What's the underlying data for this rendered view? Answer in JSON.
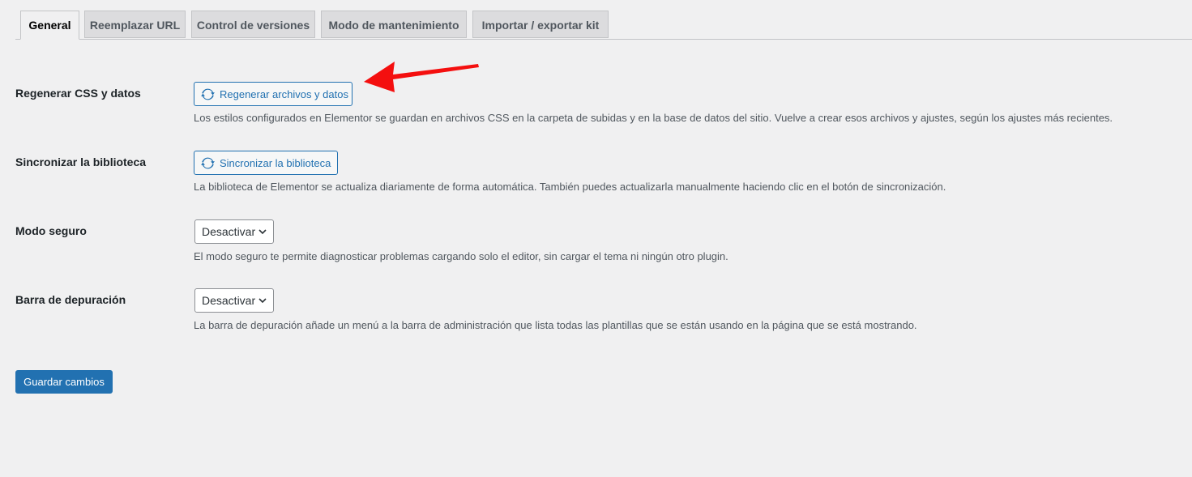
{
  "tabs": [
    {
      "label": "General",
      "active": true
    },
    {
      "label": "Reemplazar URL",
      "active": false
    },
    {
      "label": "Control de versiones",
      "active": false
    },
    {
      "label": "Modo de mantenimiento",
      "active": false
    },
    {
      "label": "Importar / exportar kit",
      "active": false
    }
  ],
  "rows": {
    "regenerate": {
      "label": "Regenerar CSS y datos",
      "button": "Regenerar archivos y datos",
      "icon": "sync-icon",
      "description": "Los estilos configurados en Elementor se guardan en archivos CSS en la carpeta de subidas y en la base de datos del sitio. Vuelve a crear esos archivos y ajustes, según los ajustes más recientes."
    },
    "sync": {
      "label": "Sincronizar la biblioteca",
      "button": "Sincronizar la biblioteca",
      "icon": "sync-icon",
      "description": "La biblioteca de Elementor se actualiza diariamente de forma automática. También puedes actualizarla manualmente haciendo clic en el botón de sincronización."
    },
    "safe_mode": {
      "label": "Modo seguro",
      "value": "Desactivar",
      "description": "El modo seguro te permite diagnosticar problemas cargando solo el editor, sin cargar el tema ni ningún otro plugin."
    },
    "debug_bar": {
      "label": "Barra de depuración",
      "value": "Desactivar",
      "description": "La barra de depuración añade un menú a la barra de administración que lista todas las plantillas que se están usando en la página que se está mostrando."
    }
  },
  "save_label": "Guardar cambios",
  "colors": {
    "accent": "#2271b1",
    "annotation_arrow": "#f40f0f",
    "background": "#f0f0f1"
  }
}
